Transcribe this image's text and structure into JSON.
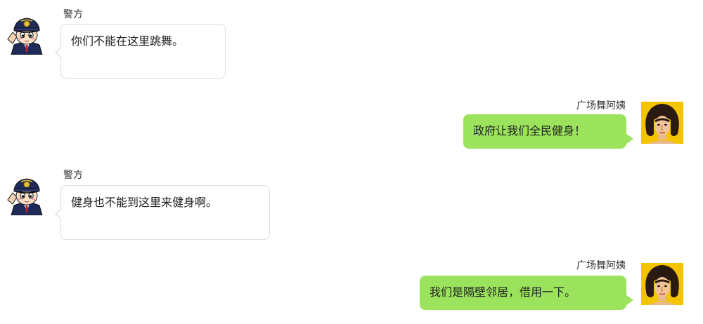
{
  "colors": {
    "received_bubble_bg": "#ffffff",
    "received_bubble_border": "#dedede",
    "sent_bubble_bg": "#9be35c",
    "text": "#222222"
  },
  "messages": [
    {
      "side": "left",
      "sender": "警方",
      "avatar": "police-officer-avatar",
      "text": "你们不能在这里跳舞。"
    },
    {
      "side": "right",
      "sender": "广场舞阿姨",
      "avatar": "auntie-avatar",
      "text": "政府让我们全民健身！"
    },
    {
      "side": "left",
      "sender": "警方",
      "avatar": "police-officer-avatar",
      "text": "健身也不能到这里来健身啊。"
    },
    {
      "side": "right",
      "sender": "广场舞阿姨",
      "avatar": "auntie-avatar",
      "text": "我们是隔壁邻居，借用一下。"
    }
  ]
}
